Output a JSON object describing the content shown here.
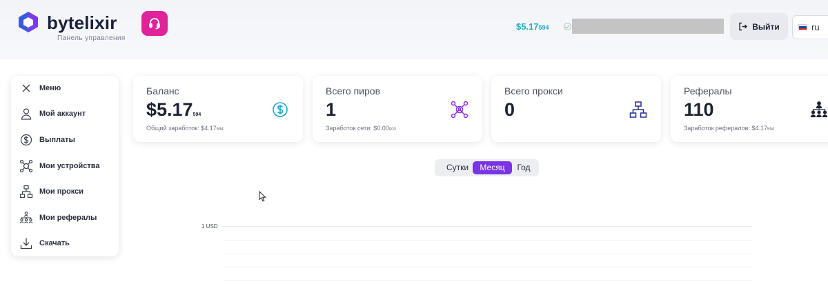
{
  "header": {
    "brand": "bytelixir",
    "subtitle": "Панель управления",
    "balance_main": "$5.17",
    "balance_small": "594",
    "logout_label": "Выйти",
    "language": "ru"
  },
  "sidebar": {
    "items": [
      {
        "label": "Меню",
        "icon": "close-icon"
      },
      {
        "label": "Мой аккаунт",
        "icon": "user-icon"
      },
      {
        "label": "Выплаты",
        "icon": "dollar-icon"
      },
      {
        "label": "Мои устройства",
        "icon": "devices-icon"
      },
      {
        "label": "Мои прокси",
        "icon": "network-icon"
      },
      {
        "label": "Мои рефералы",
        "icon": "referrals-icon"
      },
      {
        "label": "Скачать",
        "icon": "download-icon"
      }
    ]
  },
  "cards": [
    {
      "title": "Баланс",
      "value": "$5.17",
      "value_small": "594",
      "sub": "Общий заработок: $4.17",
      "sub_small": "594",
      "icon": "dollar-circle-icon",
      "icon_color": "#1aa7c9"
    },
    {
      "title": "Всего пиров",
      "value": "1",
      "value_small": "",
      "sub": "Заработок сети: $0.00",
      "sub_small": "000",
      "icon": "peers-icon",
      "icon_color": "#8b2cd9"
    },
    {
      "title": "Всего прокси",
      "value": "0",
      "value_small": "",
      "sub": "",
      "sub_small": "",
      "icon": "proxy-network-icon",
      "icon_color": "#2e3a8c"
    },
    {
      "title": "Рефералы",
      "value": "110",
      "value_small": "",
      "sub": "Заработок рефералов: $4.17",
      "sub_small": "594",
      "icon": "referral-people-icon",
      "icon_color": "#1d2232"
    }
  ],
  "period_selector": {
    "options": [
      "Сутки",
      "Месяц",
      "Год"
    ],
    "selected": "Месяц"
  },
  "chart": {
    "y_tick_label": "1 USD"
  },
  "colors": {
    "accent": "#7a34e6",
    "balance": "#22a9c7",
    "support": "#e0229b"
  }
}
